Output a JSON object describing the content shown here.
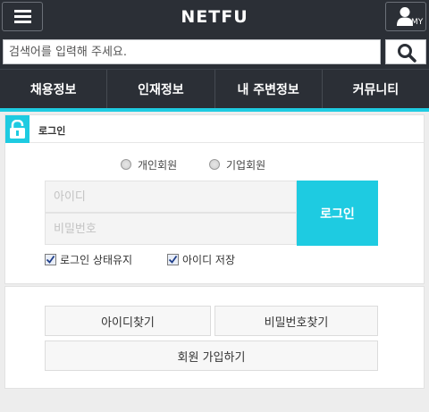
{
  "header": {
    "logo": "NETFU",
    "my_label": "MY",
    "menu_icon": "hamburger-icon",
    "user_icon": "user-icon"
  },
  "search": {
    "placeholder": "검색어를 입력해 주세요.",
    "button_icon": "search-icon"
  },
  "nav": {
    "items": [
      "채용정보",
      "인재정보",
      "내 주변정보",
      "커뮤니티"
    ]
  },
  "login": {
    "title": "로그인",
    "title_icon": "lock-icon",
    "member_types": [
      {
        "label": "개인회원",
        "selected": false
      },
      {
        "label": "기업회원",
        "selected": false
      }
    ],
    "id_placeholder": "아이디",
    "password_placeholder": "비밀번호",
    "login_button": "로그인",
    "options": [
      {
        "label": "로그인 상태유지",
        "checked": true
      },
      {
        "label": "아이디 저장",
        "checked": true
      }
    ]
  },
  "account": {
    "find_id": "아이디찾기",
    "find_password": "비밀번호찾기",
    "signup": "회원 가입하기"
  },
  "colors": {
    "header_bg": "#2b2f36",
    "accent": "#1ecbe1"
  }
}
